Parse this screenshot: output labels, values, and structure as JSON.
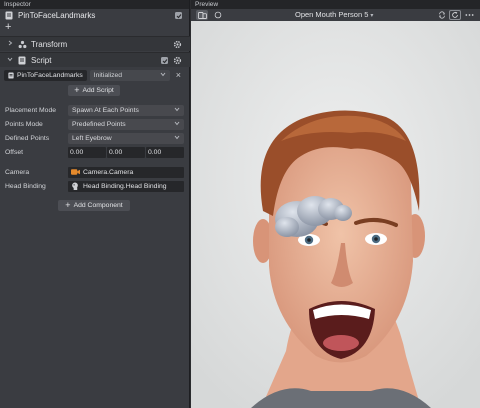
{
  "inspector": {
    "title": "Inspector",
    "object_name": "PinToFaceLandmarks",
    "add_symbol": "+",
    "transform": {
      "label": "Transform"
    },
    "script": {
      "label": "Script",
      "script_name": "PinToFaceLandmarks",
      "status": "Initialized",
      "close_symbol": "×",
      "add_script_label": "Add Script",
      "properties": {
        "placement_mode": {
          "label": "Placement Mode",
          "value": "Spawn At Each Points"
        },
        "points_mode": {
          "label": "Points Mode",
          "value": "Predefined Points"
        },
        "defined_points": {
          "label": "Defined Points",
          "value": "Left Eyebrow"
        },
        "offset": {
          "label": "Offset",
          "x": "0.00",
          "y": "0.00",
          "z": "0.00"
        },
        "camera": {
          "label": "Camera",
          "value": "Camera.Camera"
        },
        "head_binding": {
          "label": "Head Binding",
          "value": "Head Binding.Head Binding"
        }
      },
      "add_component_label": "Add Component"
    }
  },
  "preview": {
    "title": "Preview",
    "person_label": "Open Mouth Person 5"
  },
  "colors": {
    "panel_bg": "#3a3c41",
    "header_bg": "#242528",
    "field_dark": "#26272a",
    "select_bg": "#48494e",
    "camera_icon": "#e58a2c",
    "viewport_bg": "#e3e4e4"
  },
  "icons": [
    "chevron-right-icon",
    "chevron-down-icon",
    "transform-icon",
    "script-icon",
    "gear-icon",
    "checkbox-icon",
    "close-icon",
    "camera-icon",
    "head-binding-icon",
    "device-icon",
    "circle-icon",
    "refresh-icon",
    "more-icon"
  ]
}
